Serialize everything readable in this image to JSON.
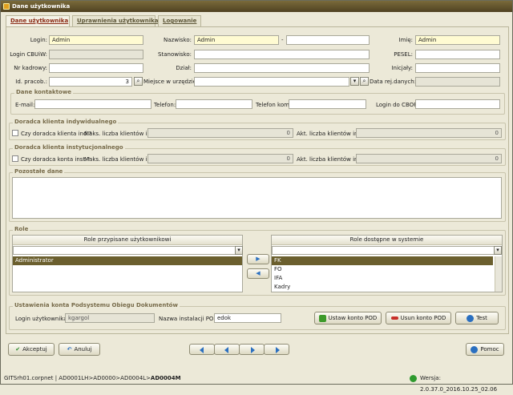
{
  "window": {
    "title": "Dane użytkownika"
  },
  "tabs": [
    "Dane użytkownika",
    "Uprawnienia użytkownika",
    "Logowanie"
  ],
  "form": {
    "login_label": "Login:",
    "login_value": "Admin",
    "nazwisko_label": "Nazwisko:",
    "nazwisko_value": "Admin",
    "nazwisko_sep": "-",
    "imie_label": "Imię:",
    "imie_value": "Admin",
    "login_cbuw_label": "Login CBUiW:",
    "stanowisko_label": "Stanowisko:",
    "pesel_label": "PESEL:",
    "nr_kadrowy_label": "Nr kadrowy:",
    "dzial_label": "Dział:",
    "inicjaly_label": "Inicjały:",
    "id_pracob_label": "Id. pracob.:",
    "id_pracob_value": "3",
    "miejsce_label": "Miejsce w urzędzie:",
    "data_rej_label": "Data rej.danych:"
  },
  "contact": {
    "title": "Dane kontaktowe",
    "email_label": "E-mail:",
    "telefon_label": "Telefon:",
    "telefon_kom_label": "Telefon kom:",
    "login_cbop_label": "Login do CBOP:"
  },
  "doradca_ind": {
    "title": "Doradca klienta indywidualnego",
    "checkbox_label": "Czy doradca klienta ind.?",
    "maks_label": "Maks. liczba klientów ind.:",
    "maks_value": "0",
    "akt_label": "Akt. liczba klientów ind.:",
    "akt_value": "0"
  },
  "doradca_inst": {
    "title": "Doradca klienta instytucjonalnego",
    "checkbox_label": "Czy doradca konta inst.?",
    "maks_label": "Maks. liczba klientów inst.:",
    "maks_value": "0",
    "akt_label": "Akt. liczba klientów inst.:",
    "akt_value": "0"
  },
  "pozostale": {
    "title": "Pozostałe dane"
  },
  "role": {
    "title": "Role",
    "assigned_header": "Role przypisane użytkownikowi",
    "assigned": [
      "Administrator"
    ],
    "available_header": "Role dostępne w systemie",
    "available": [
      "FK",
      "FO",
      "IFA",
      "Kadry"
    ]
  },
  "pod": {
    "title": "Ustawienia konta Podsystemu Obiegu Dokumentów",
    "login_label": "Login użytkownika:",
    "login_value": "kgargol",
    "instalacja_label": "Nazwa instalacji POD:",
    "instalacja_value": "edok",
    "ustaw_button": "Ustaw konto POD",
    "usun_button": "Usun konto POD",
    "test_button": "Test"
  },
  "footer": {
    "akceptuj": "Akceptuj",
    "anuluj": "Anuluj",
    "pomoc": "Pomoc"
  },
  "status": {
    "path": "GITSrh01.corpnet | AD0001LH>AD0000>AD0004L>",
    "path_bold": "AD0004M",
    "version": "Wersja: 2.0.37.0_2016.10.25_02.06"
  },
  "colors": {
    "accent": "#6b5f2e",
    "tab_active": "#8a2a15",
    "group_title": "#776b4a"
  }
}
